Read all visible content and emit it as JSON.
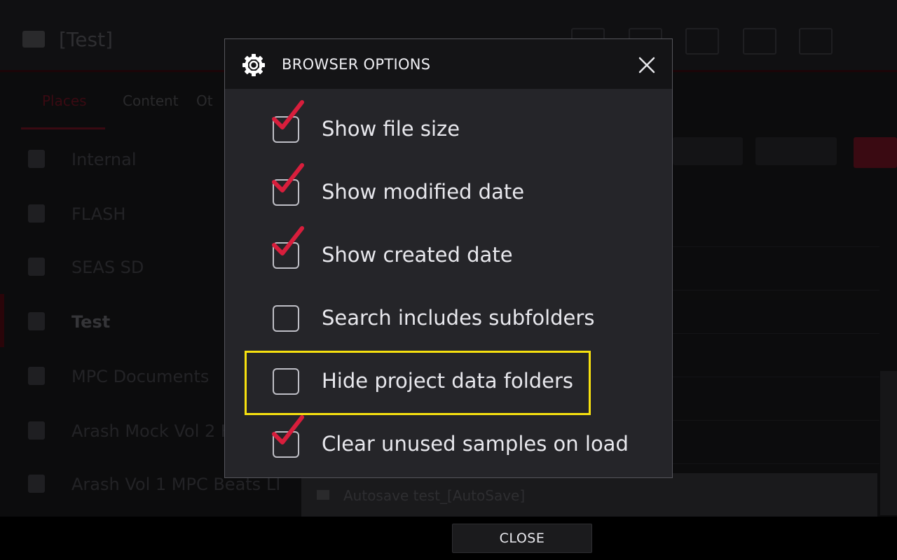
{
  "background": {
    "title": "[Test]",
    "tabs": [
      "Places",
      "Content",
      "Ot"
    ],
    "sidebar": [
      {
        "label": "Internal",
        "active": false
      },
      {
        "label": "FLASH",
        "active": false
      },
      {
        "label": "SEAS SD",
        "active": false
      },
      {
        "label": "Test",
        "active": true
      },
      {
        "label": "MPC Documents",
        "active": false
      },
      {
        "label": "Arash Mock Vol 2 K",
        "active": false
      },
      {
        "label": "Arash Vol 1 MPC Beats LI",
        "active": false
      }
    ],
    "last_row_label": "Autosave test_[AutoSave]"
  },
  "dialog": {
    "title": "BROWSER OPTIONS",
    "gear_icon": "gear-icon",
    "close_icon": "close-icon",
    "accent_color": "#d81e3c",
    "highlight_color": "#f7e10f",
    "options": [
      {
        "label": "Show file size",
        "checked": true
      },
      {
        "label": "Show modified date",
        "checked": true
      },
      {
        "label": "Show created date",
        "checked": true
      },
      {
        "label": "Search includes subfolders",
        "checked": false
      },
      {
        "label": "Hide project data folders",
        "checked": false,
        "highlighted": true
      },
      {
        "label": "Clear unused samples on load",
        "checked": true
      }
    ]
  },
  "footer": {
    "close_label": "CLOSE"
  }
}
